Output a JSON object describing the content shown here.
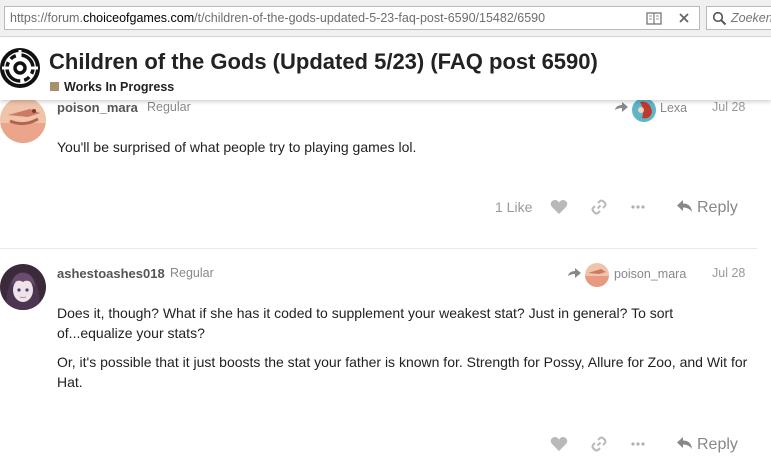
{
  "browser": {
    "url_prefix": "https://forum.",
    "url_domain": "choiceofgames.com",
    "url_path": "/t/children-of-the-gods-updated-5-23-faq-post-6590/15482/6590",
    "search_placeholder": "Zoeken"
  },
  "topic": {
    "title": "Children of the Gods (Updated 5/23) (FAQ post 6590)",
    "category": "Works In Progress",
    "category_color": "#a5916a"
  },
  "posts": [
    {
      "username": "poison_mara",
      "user_title": "Regular",
      "reply_to": "Lexa",
      "date": "Jul 28",
      "paragraphs": [
        "You'll be surprised of what people try to playing games lol."
      ],
      "likes": "1 Like",
      "reply_label": "Reply"
    },
    {
      "username": "ashestoashes018",
      "user_title": "Regular",
      "reply_to": "poison_mara",
      "date": "Jul 28",
      "paragraphs": [
        "Does it, though? What if she has it coded to supplement your weakest stat? Just in general? To sort of...equalize your stats?",
        "Or, it's possible that it just boosts the stat your father is known for. Strength for Possy, Allure for Zoo, and Wit for Hat."
      ],
      "reply_label": "Reply"
    }
  ],
  "icons": {
    "reader": "reader-view-icon",
    "close": "close-icon",
    "search": "search-icon",
    "heart": "heart-icon",
    "link": "link-icon",
    "more": "more-dots-icon",
    "reply": "reply-arrow-icon",
    "reply_to": "reply-to-arrow-icon"
  }
}
